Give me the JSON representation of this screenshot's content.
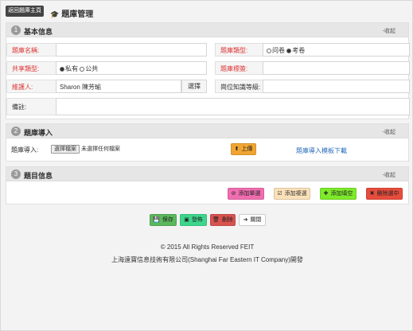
{
  "header": {
    "back_label": "返回題庫主頁",
    "title": "題庫管理"
  },
  "sections": {
    "basic": {
      "num": "1",
      "title": "基本信息",
      "collapse": "-收起",
      "bank_name_label": "題庫名稱:",
      "bank_name_value": "",
      "bank_type_label": "題庫類型:",
      "bank_type_options": [
        "问卷",
        "考卷"
      ],
      "bank_type_selected": "考卷",
      "share_type_label": "共享類型:",
      "share_type_options": [
        "私有",
        "公共"
      ],
      "share_type_selected": "私有",
      "bank_tags_label": "題庫標簽:",
      "bank_tags_value": "",
      "maintainer_label": "維護人:",
      "maintainer_value": "Sharon 陳芳瑜",
      "select_label": "選擇",
      "position_label": "崗位知識等級:",
      "position_value": "",
      "remark_label": "備註:",
      "remark_value": ""
    },
    "import": {
      "num": "2",
      "title": "題庫導入",
      "collapse": "-收起",
      "import_label": "題庫導入:",
      "file_button": "選擇檔案",
      "file_status": "未選擇任何檔案",
      "upload_label": "上傳",
      "template_link": "題庫導入模板下載"
    },
    "questions": {
      "num": "3",
      "title": "題目信息",
      "collapse": "-收起",
      "add_single": "添加單選",
      "add_multi": "添加複選",
      "add_fill": "添加填空",
      "delete_selected": "刪除選中"
    }
  },
  "actions": {
    "save": "保存",
    "publish": "發佈",
    "delete": "刪除",
    "close": "關閉"
  },
  "footer": {
    "copyright": "© 2015 All Rights Reserved FEIT",
    "developer": "上海遠寶信息技術有限公司(Shanghai Far Eastern IT Company)開發"
  },
  "colors": {
    "add_single": "#f06db0",
    "add_multi": "#fbe1b8",
    "add_fill": "#7dea2a",
    "delete_selected": "#e74c3c",
    "upload": "#f0a531",
    "save": "#5cb85c",
    "publish": "#3dd68c",
    "delete": "#d9534f",
    "close": "#ffffff"
  }
}
